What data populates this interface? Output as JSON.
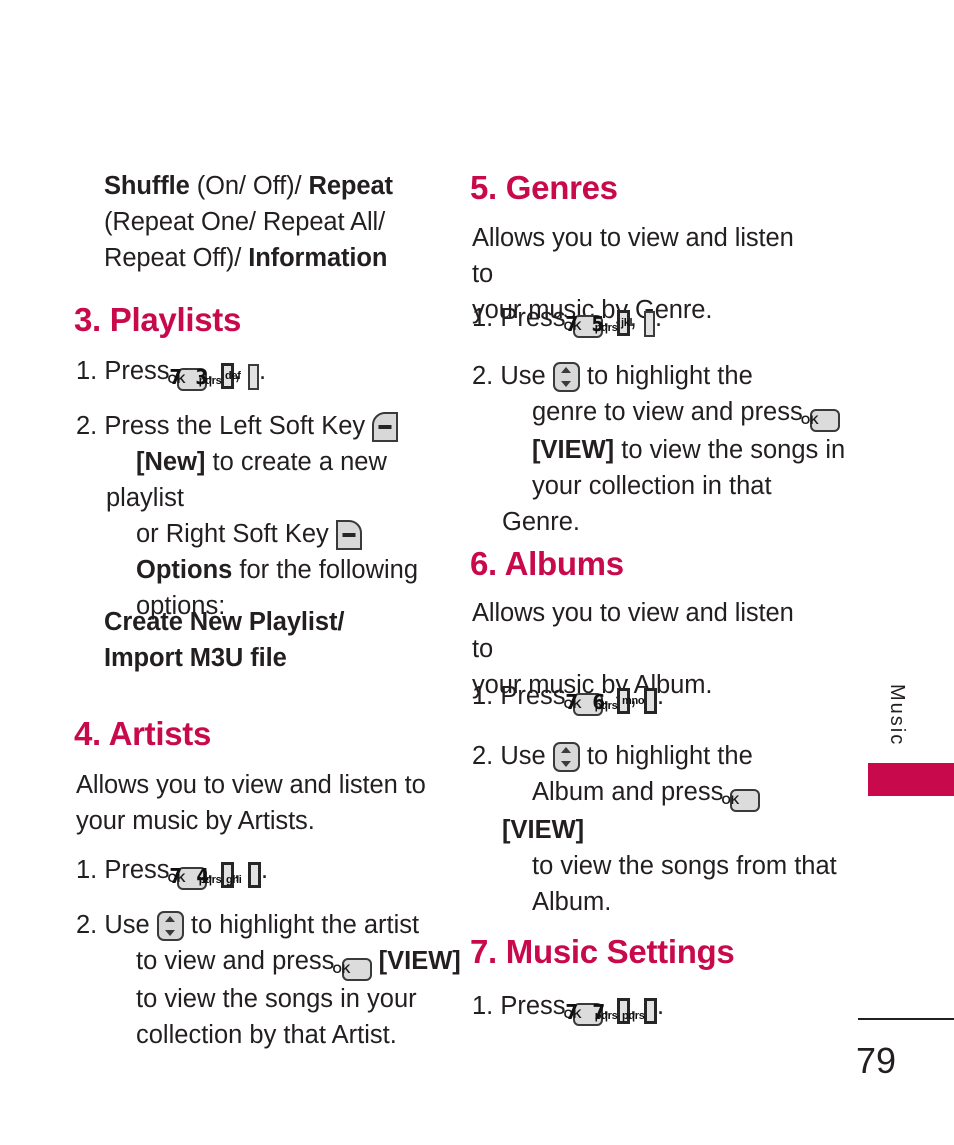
{
  "page": {
    "number": "79",
    "side_tab_label": "Music",
    "accent_color": "#c8094b",
    "text_color": "#231f20"
  },
  "left_column": {
    "options_para": {
      "p1_bold": "Shuffle",
      "p1_normal": " (On/ Off)/ ",
      "p1_bold2": "Repeat",
      "p2_normal": "(Repeat One/ Repeat All/",
      "p3_normal": "Repeat Off)/ ",
      "p3_bold": "Information"
    },
    "section_playlists": {
      "heading": "3. Playlists",
      "step1_prefix": "1. Press ",
      "step1_keys": [
        {
          "type": "ok",
          "label": "OK"
        },
        {
          "type": "num",
          "digit": "7",
          "sub": "pqrs"
        },
        {
          "type": "num",
          "digit": "3",
          "sub": "def"
        }
      ],
      "step1_suffix": ".",
      "step2_line1": "2. Press the Left Soft Key ",
      "step2_line2_bold": "[New]",
      "step2_line2_rest": " to create a new playlist",
      "step2_line3": "or Right Soft Key ",
      "step2_line4_bold": "Options",
      "step2_line4_rest": " for the following",
      "step2_line5": "options:",
      "options_list_line1": "Create New Playlist/",
      "options_list_line2": "Import M3U file"
    },
    "section_artists": {
      "heading": "4. Artists",
      "desc_line1": "Allows you to view and listen to",
      "desc_line2": "your music by Artists.",
      "step1_prefix": "1. Press ",
      "step1_keys": [
        {
          "type": "ok",
          "label": "OK"
        },
        {
          "type": "num",
          "digit": "7",
          "sub": "pqrs"
        },
        {
          "type": "num",
          "digit": "4",
          "sub": "ghi"
        }
      ],
      "step1_suffix": ".",
      "step2_prefix": "2. Use ",
      "step2_line1_rest": " to highlight the artist",
      "step2_line2_a": "to view and press ",
      "step2_line2_bold": "[VIEW]",
      "step2_line3": "to view the songs in your",
      "step2_line4": "collection by that Artist."
    }
  },
  "right_column": {
    "section_genres": {
      "heading": "5. Genres",
      "desc_line1": "Allows you to view and listen to",
      "desc_line2": "your music by Genre.",
      "step1_prefix": "1. Press ",
      "step1_keys": [
        {
          "type": "ok",
          "label": "OK"
        },
        {
          "type": "num",
          "digit": "7",
          "sub": "pqrs"
        },
        {
          "type": "num",
          "digit": "5",
          "sub": "jkl"
        }
      ],
      "step1_suffix": ".",
      "step2_prefix": "2. Use ",
      "step2_line1_rest": " to highlight the",
      "step2_line2_a": "genre to view and press ",
      "step2_line3_bold": "[VIEW]",
      "step2_line3_rest": " to view the songs in",
      "step2_line4": "your collection in that Genre."
    },
    "section_albums": {
      "heading": "6. Albums",
      "desc_line1": "Allows you to view and listen to",
      "desc_line2": "your music by Album.",
      "step1_prefix": "1. Press ",
      "step1_keys": [
        {
          "type": "ok",
          "label": "OK"
        },
        {
          "type": "num",
          "digit": "7",
          "sub": "pqrs"
        },
        {
          "type": "num",
          "digit": "6",
          "sub": "mno"
        }
      ],
      "step1_suffix": ".",
      "step2_prefix": "2. Use ",
      "step2_line1_rest": " to highlight the",
      "step2_line2_a": "Album and press ",
      "step2_line2_bold": "[VIEW]",
      "step2_line3": "to view the songs from that",
      "step2_line4": "Album."
    },
    "section_music_settings": {
      "heading": "7. Music Settings",
      "step1_prefix": "1. Press ",
      "step1_keys": [
        {
          "type": "ok",
          "label": "OK"
        },
        {
          "type": "num",
          "digit": "7",
          "sub": "pqrs"
        },
        {
          "type": "num",
          "digit": "7",
          "sub": "pqrs"
        }
      ],
      "step1_suffix": "."
    }
  },
  "key_glyphs": {
    "ok": "OK",
    "left_soft_key": "left-soft-key",
    "right_soft_key": "right-soft-key",
    "nav_updown": "nav-up-down-key"
  }
}
